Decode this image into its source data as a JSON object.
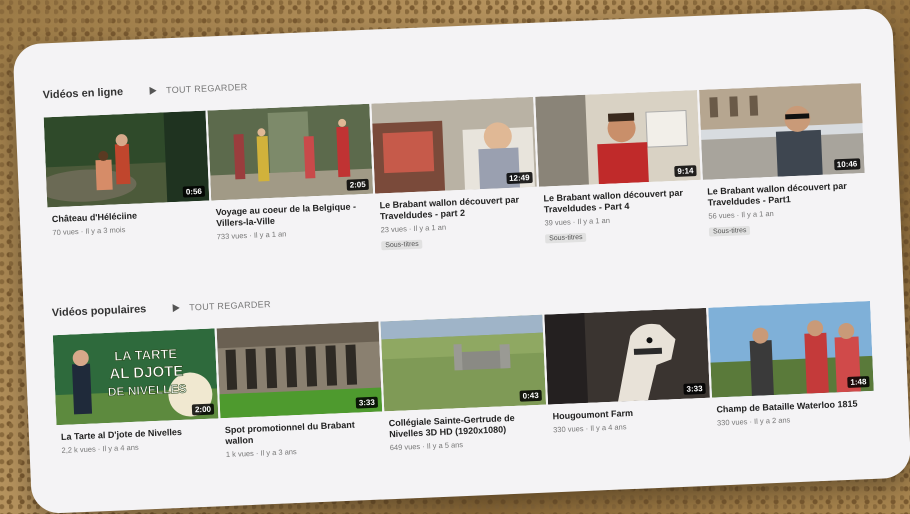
{
  "sections": [
    {
      "title": "Vidéos en ligne",
      "see_all": "TOUT REGARDER",
      "videos": [
        {
          "title": "Château d'Héléciine",
          "meta": "70 vues · Il y a 3 mois",
          "duration": "0:56",
          "badge": ""
        },
        {
          "title": "Voyage au coeur de la Belgique - Villers-la-Ville",
          "meta": "733 vues · Il y a 1 an",
          "duration": "2:05",
          "badge": ""
        },
        {
          "title": "Le Brabant wallon découvert par Traveldudes - part 2",
          "meta": "23 vues · Il y a 1 an",
          "duration": "12:49",
          "badge": "Sous-titres"
        },
        {
          "title": "Le Brabant wallon découvert par Traveldudes - Part 4",
          "meta": "39 vues · Il y a 1 an",
          "duration": "9:14",
          "badge": "Sous-titres"
        },
        {
          "title": "Le Brabant wallon découvert par Traveldudes - Part1",
          "meta": "56 vues · Il y a 1 an",
          "duration": "10:46",
          "badge": "Sous-titres"
        }
      ]
    },
    {
      "title": "Vidéos populaires",
      "see_all": "TOUT REGARDER",
      "videos": [
        {
          "title": "La Tarte al D'jote de Nivelles",
          "meta": "2,2 k vues · Il y a 4 ans",
          "duration": "2:00",
          "badge": "",
          "overlay": [
            "LA TARTE",
            "AL DJOTE",
            "DE NIVELLES"
          ]
        },
        {
          "title": "Spot promotionnel du Brabant wallon",
          "meta": "1 k vues · Il y a 3 ans",
          "duration": "3:33",
          "badge": ""
        },
        {
          "title": "Collégiale Sainte-Gertrude de Nivelles 3D HD (1920x1080)",
          "meta": "649 vues · Il y a 5 ans",
          "duration": "0:43",
          "badge": ""
        },
        {
          "title": "Hougoumont Farm",
          "meta": "330 vues · Il y a 4 ans",
          "duration": "3:33",
          "badge": ""
        },
        {
          "title": "Champ de Bataille Waterloo 1815",
          "meta": "330 vues · Il y a 2 ans",
          "duration": "1:48",
          "badge": ""
        }
      ]
    }
  ]
}
